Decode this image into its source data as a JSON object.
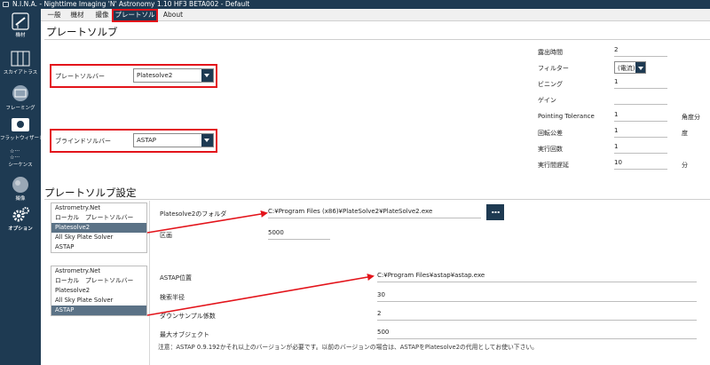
{
  "window": {
    "title": "N.I.N.A. - Nighttime Imaging 'N' Astronomy 1.10 HF3 BETA002  -  Default"
  },
  "sidebar": {
    "items": [
      {
        "label": "機材",
        "icon": "equipment-icon"
      },
      {
        "label": "スカイアトラス",
        "icon": "sky-atlas-icon"
      },
      {
        "label": "フレーミング",
        "icon": "framing-icon"
      },
      {
        "label": "フラットウィザード",
        "icon": "flat-wizard-icon"
      },
      {
        "label": "シーケンス",
        "icon": "sequence-icon"
      },
      {
        "label": "撮像",
        "icon": "imaging-icon"
      },
      {
        "label": "オプション",
        "icon": "options-icon"
      }
    ]
  },
  "tabs": [
    "一般",
    "機材",
    "撮像",
    "プレートソルブ",
    "About"
  ],
  "active_tab": "プレートソルブ",
  "section1": {
    "title": "プレートソルブ",
    "plate_solver_label": "プレートソルバー",
    "plate_solver_value": "Platesolve2",
    "blind_solver_label": "ブラインドソルバー",
    "blind_solver_value": "ASTAP"
  },
  "settings": {
    "rows": [
      {
        "label": "露出時間",
        "value": "2",
        "unit": ""
      },
      {
        "label": "フィルター",
        "value": "(電流)",
        "unit": ""
      },
      {
        "label": "ビニング",
        "value": "1",
        "unit": ""
      },
      {
        "label": "ゲイン",
        "value": "",
        "unit": ""
      },
      {
        "label": "Pointing Tolerance",
        "value": "1",
        "unit": "角度分"
      },
      {
        "label": "回転公差",
        "value": "1",
        "unit": "度"
      },
      {
        "label": "実行回数",
        "value": "1",
        "unit": ""
      },
      {
        "label": "実行間遅延",
        "value": "10",
        "unit": "分"
      }
    ]
  },
  "section2": {
    "title": "プレートソルブ設定",
    "list1": [
      "Astrometry.Net",
      "ローカル　プレートソルバー",
      "Platesolve2",
      "All Sky Plate Solver",
      "ASTAP"
    ],
    "list1_selected": "Platesolve2",
    "list2": [
      "Astrometry.Net",
      "ローカル　プレートソルバー",
      "Platesolve2",
      "All Sky Plate Solver",
      "ASTAP"
    ],
    "list2_selected": "ASTAP",
    "ps2_folder_label": "Platesolve2のフォルダ",
    "ps2_folder_value": "C:¥Program Files (x86)¥PlateSolve2¥PlateSolve2.exe",
    "browse_label": "...",
    "ps2_region_label": "区画",
    "ps2_region_value": "5000",
    "astap_location_label": "ASTAP位置",
    "astap_location_value": "C:¥Program Files¥astap¥astap.exe",
    "search_radius_label": "検索半径",
    "search_radius_value": "30",
    "downsample_label": "ダウンサンプル係数",
    "downsample_value": "2",
    "max_objects_label": "最大オブジェクト",
    "max_objects_value": "500",
    "note": "注意：ASTAP 0.9.192かそれ以上のバージョンが必要です。以前のバージョンの場合は、ASTAPをPlatesolve2の代用としてお使い下さい。"
  },
  "colors": {
    "navy": "#1e3a52",
    "highlight_red": "#e3141b",
    "selected": "#5b7286"
  }
}
